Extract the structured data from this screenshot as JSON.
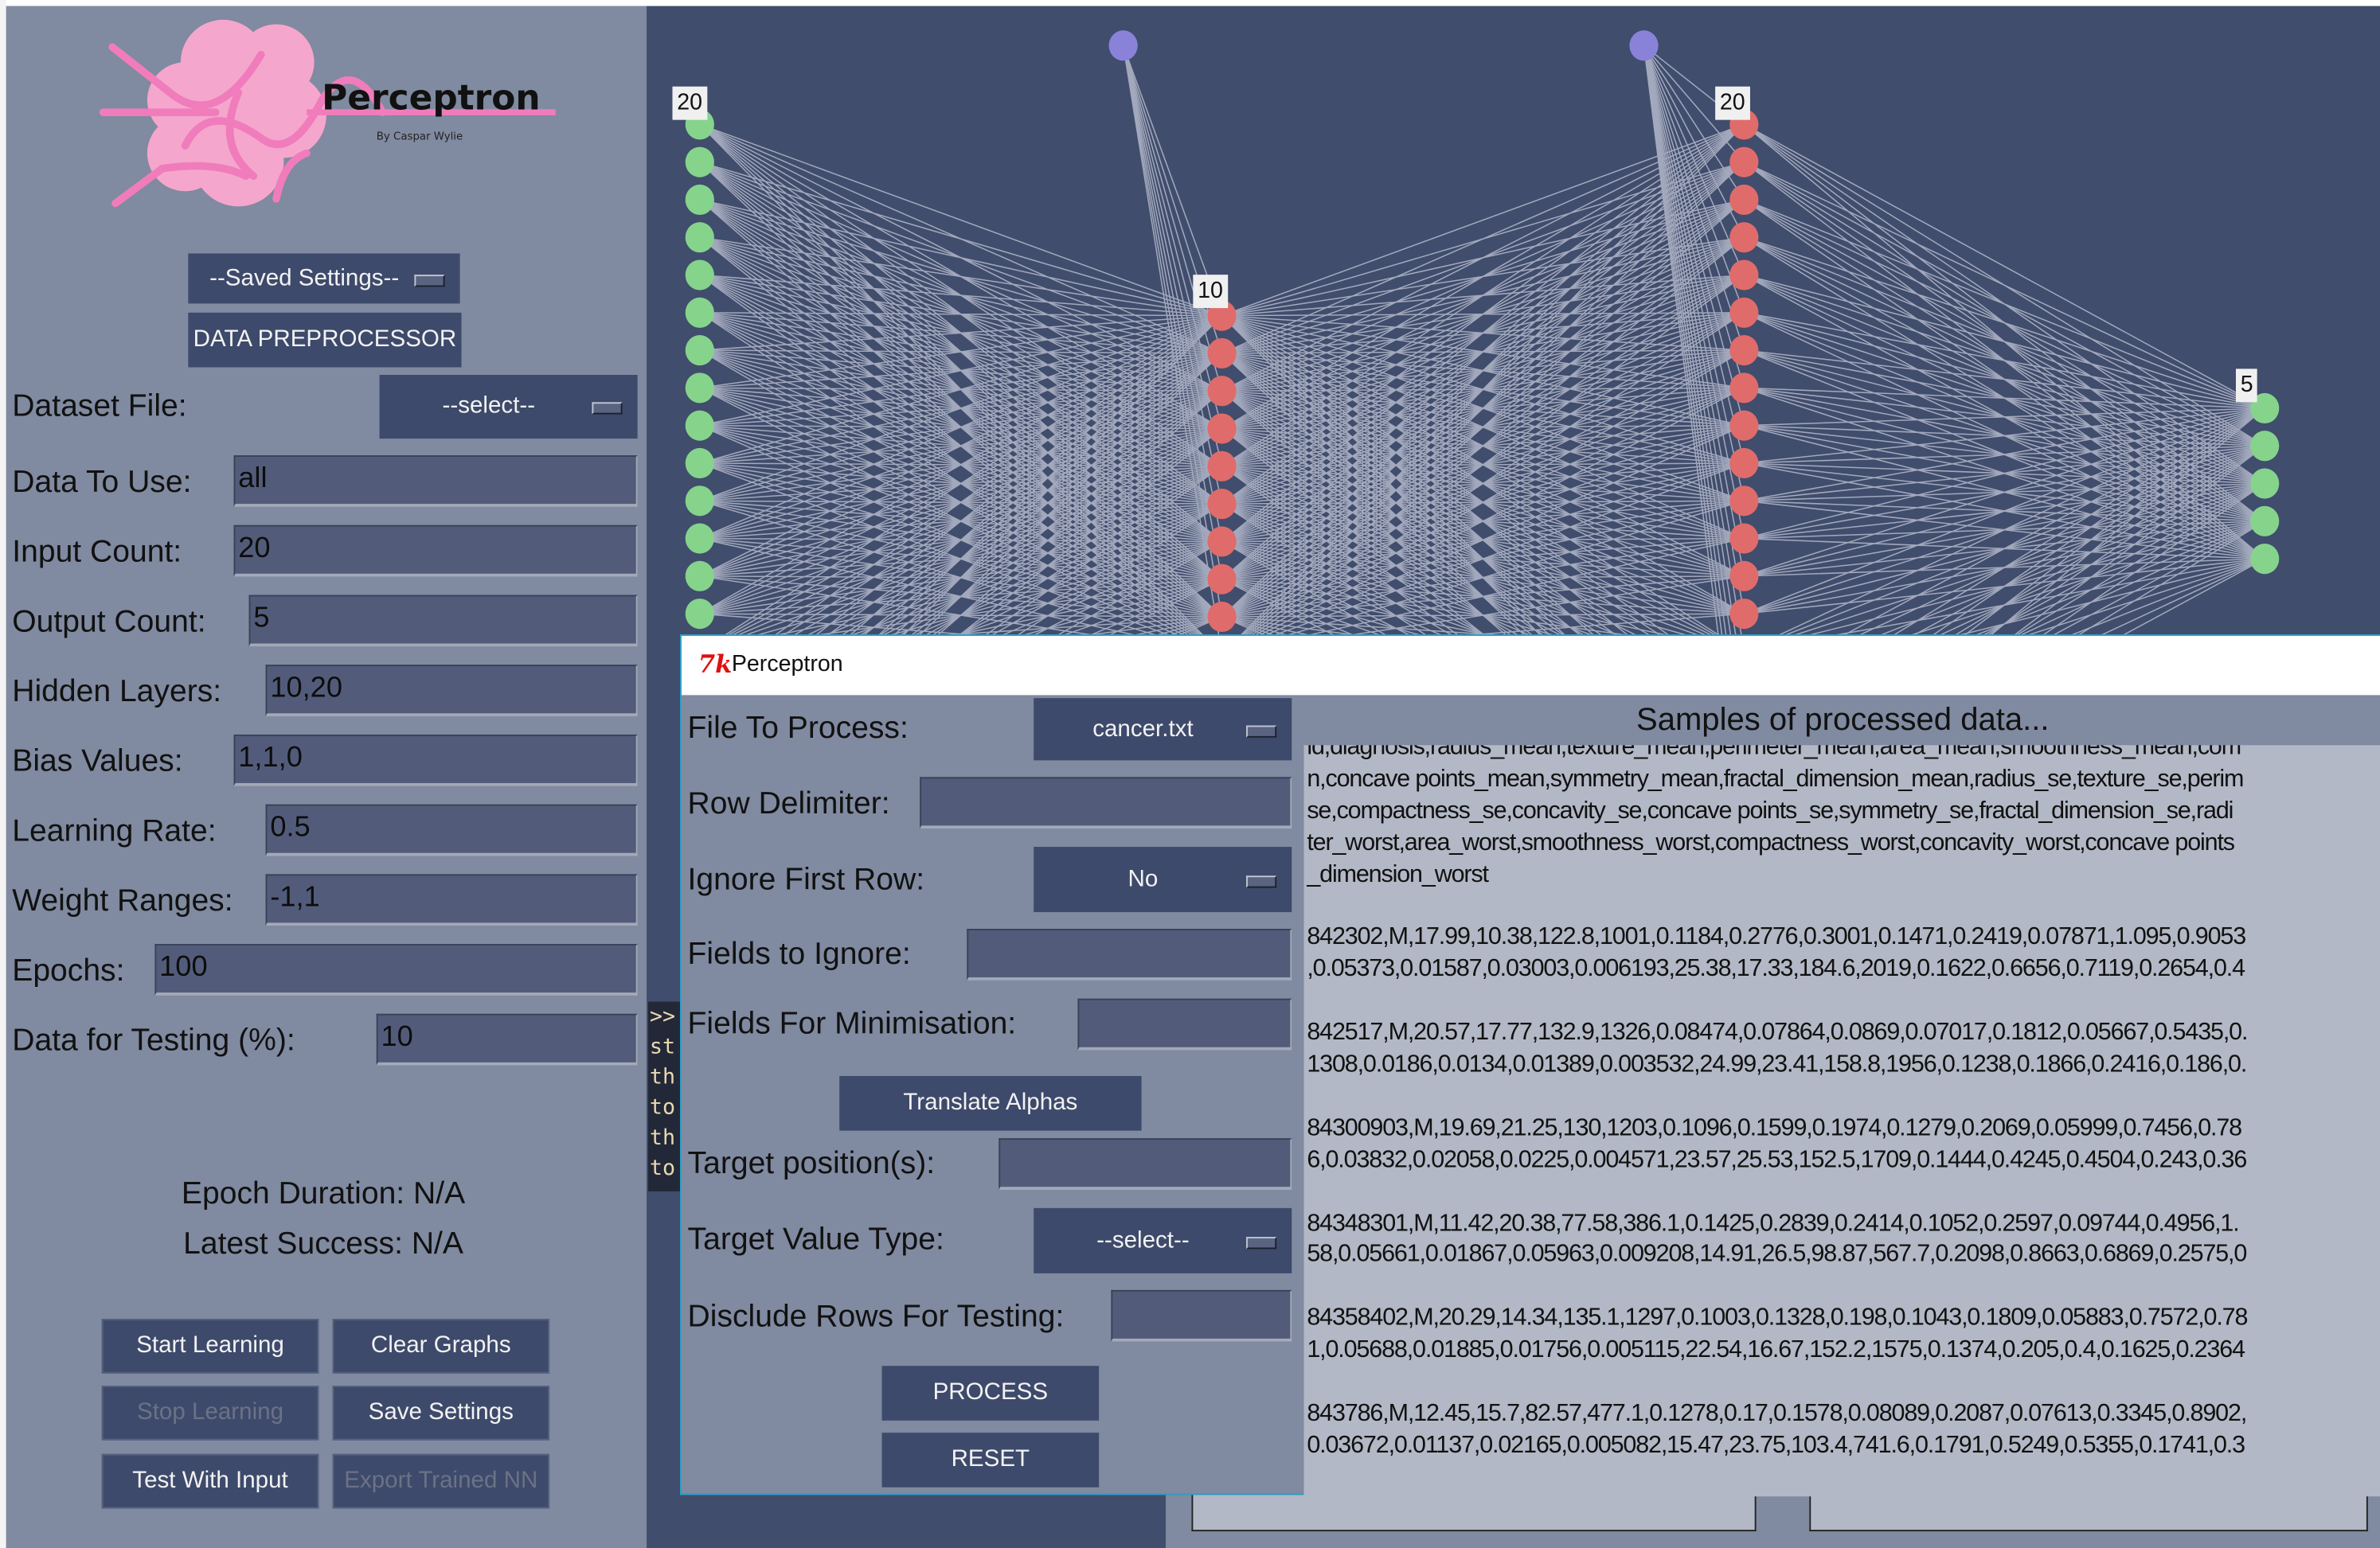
{
  "app": {
    "logo": {
      "title": "Perceptron",
      "subtitle": "By Caspar Wylie",
      "color": "#f5a6cc"
    },
    "saved_settings": {
      "value": "--Saved Settings--"
    },
    "data_preprocessor_label": "DATA PREPROCESSOR",
    "form": {
      "dataset_file": {
        "label": "Dataset File:",
        "value": "--select--"
      },
      "data_to_use": {
        "label": "Data To Use:",
        "value": "all"
      },
      "input_count": {
        "label": "Input Count:",
        "value": "20"
      },
      "output_count": {
        "label": "Output Count:",
        "value": "5"
      },
      "hidden_layers": {
        "label": "Hidden Layers:",
        "value": "10,20"
      },
      "bias_values": {
        "label": "Bias Values:",
        "value": "1,1,0"
      },
      "learning_rate": {
        "label": "Learning Rate:",
        "value": "0.5"
      },
      "weight_ranges": {
        "label": "Weight Ranges:",
        "value": "-1,1"
      },
      "epochs": {
        "label": "Epochs:",
        "value": "100"
      },
      "data_for_testing": {
        "label": "Data for Testing (%):",
        "value": "10"
      }
    },
    "status": {
      "epoch_duration": "Epoch Duration: N/A",
      "latest_success": "Latest Success: N/A"
    },
    "buttons": {
      "start_learning": "Start Learning",
      "clear_graphs": "Clear Graphs",
      "stop_learning": "Stop Learning",
      "save_settings": "Save Settings",
      "test_with_input": "Test With Input",
      "export_trained_nn": "Export Trained NN"
    },
    "console_lines": [
      ">>",
      "st",
      "th",
      "to",
      "th",
      "to"
    ]
  },
  "network": {
    "layers": [
      20,
      10,
      20,
      5
    ],
    "layer_labels": [
      "20",
      "10",
      "20",
      "5"
    ],
    "colors": {
      "input": "#86d38c",
      "hidden": "#e06b6b",
      "output": "#86d38c",
      "bias": "#8a82d8",
      "connection": "#a3a9bd",
      "background": "#404d6c"
    }
  },
  "dialog": {
    "title": "Perceptron",
    "tk_icon": "tk-feather-icon",
    "file_to_process": {
      "label": "File To Process:",
      "value": "cancer.txt"
    },
    "row_delimiter": {
      "label": "Row Delimiter:",
      "value": ""
    },
    "ignore_first_row": {
      "label": "Ignore First Row:",
      "value": "No"
    },
    "fields_to_ignore": {
      "label": "Fields to Ignore:",
      "value": ""
    },
    "fields_for_minimisation": {
      "label": "Fields For Minimisation:",
      "value": ""
    },
    "translate_alphas": "Translate Alphas",
    "target_positions": {
      "label": "Target position(s):",
      "value": ""
    },
    "target_value_type": {
      "label": "Target Value Type:",
      "value": "--select--"
    },
    "disclude_rows": {
      "label": "Disclude Rows For Testing:",
      "value": ""
    },
    "process": "PROCESS",
    "reset": "RESET",
    "samples_header": "Samples of processed data...",
    "sample_lines": [
      "id,diagnosis,radius_mean,texture_mean,perimeter_mean,area_mean,smoothness_mean,com",
      "n,concave points_mean,symmetry_mean,fractal_dimension_mean,radius_se,texture_se,perim",
      "se,compactness_se,concavity_se,concave points_se,symmetry_se,fractal_dimension_se,radi",
      "ter_worst,area_worst,smoothness_worst,compactness_worst,concavity_worst,concave points",
      "_dimension_worst",
      "",
      "842302,M,17.99,10.38,122.8,1001,0.1184,0.2776,0.3001,0.1471,0.2419,0.07871,1.095,0.9053",
      ",0.05373,0.01587,0.03003,0.006193,25.38,17.33,184.6,2019,0.1622,0.6656,0.7119,0.2654,0.4",
      "",
      "842517,M,20.57,17.77,132.9,1326,0.08474,0.07864,0.0869,0.07017,0.1812,0.05667,0.5435,0.",
      "1308,0.0186,0.0134,0.01389,0.003532,24.99,23.41,158.8,1956,0.1238,0.1866,0.2416,0.186,0.",
      "",
      "84300903,M,19.69,21.25,130,1203,0.1096,0.1599,0.1974,0.1279,0.2069,0.05999,0.7456,0.78",
      "6,0.03832,0.02058,0.0225,0.004571,23.57,25.53,152.5,1709,0.1444,0.4245,0.4504,0.243,0.36",
      "",
      "84348301,M,11.42,20.38,77.58,386.1,0.1425,0.2839,0.2414,0.1052,0.2597,0.09744,0.4956,1.",
      "58,0.05661,0.01867,0.05963,0.009208,14.91,26.5,98.87,567.7,0.2098,0.8663,0.6869,0.2575,0",
      "",
      "84358402,M,20.29,14.34,135.1,1297,0.1003,0.1328,0.198,0.1043,0.1809,0.05883,0.7572,0.78",
      "1,0.05688,0.01885,0.01756,0.005115,22.54,16.67,152.2,1575,0.1374,0.205,0.4,0.1625,0.2364",
      "",
      "843786,M,12.45,15.7,82.57,477.1,0.1278,0.17,0.1578,0.08089,0.2087,0.07613,0.3345,0.8902,",
      "0.03672,0.01137,0.02165,0.005082,15.47,23.75,103.4,741.6,0.1791,0.5249,0.5355,0.1741,0.3"
    ]
  }
}
